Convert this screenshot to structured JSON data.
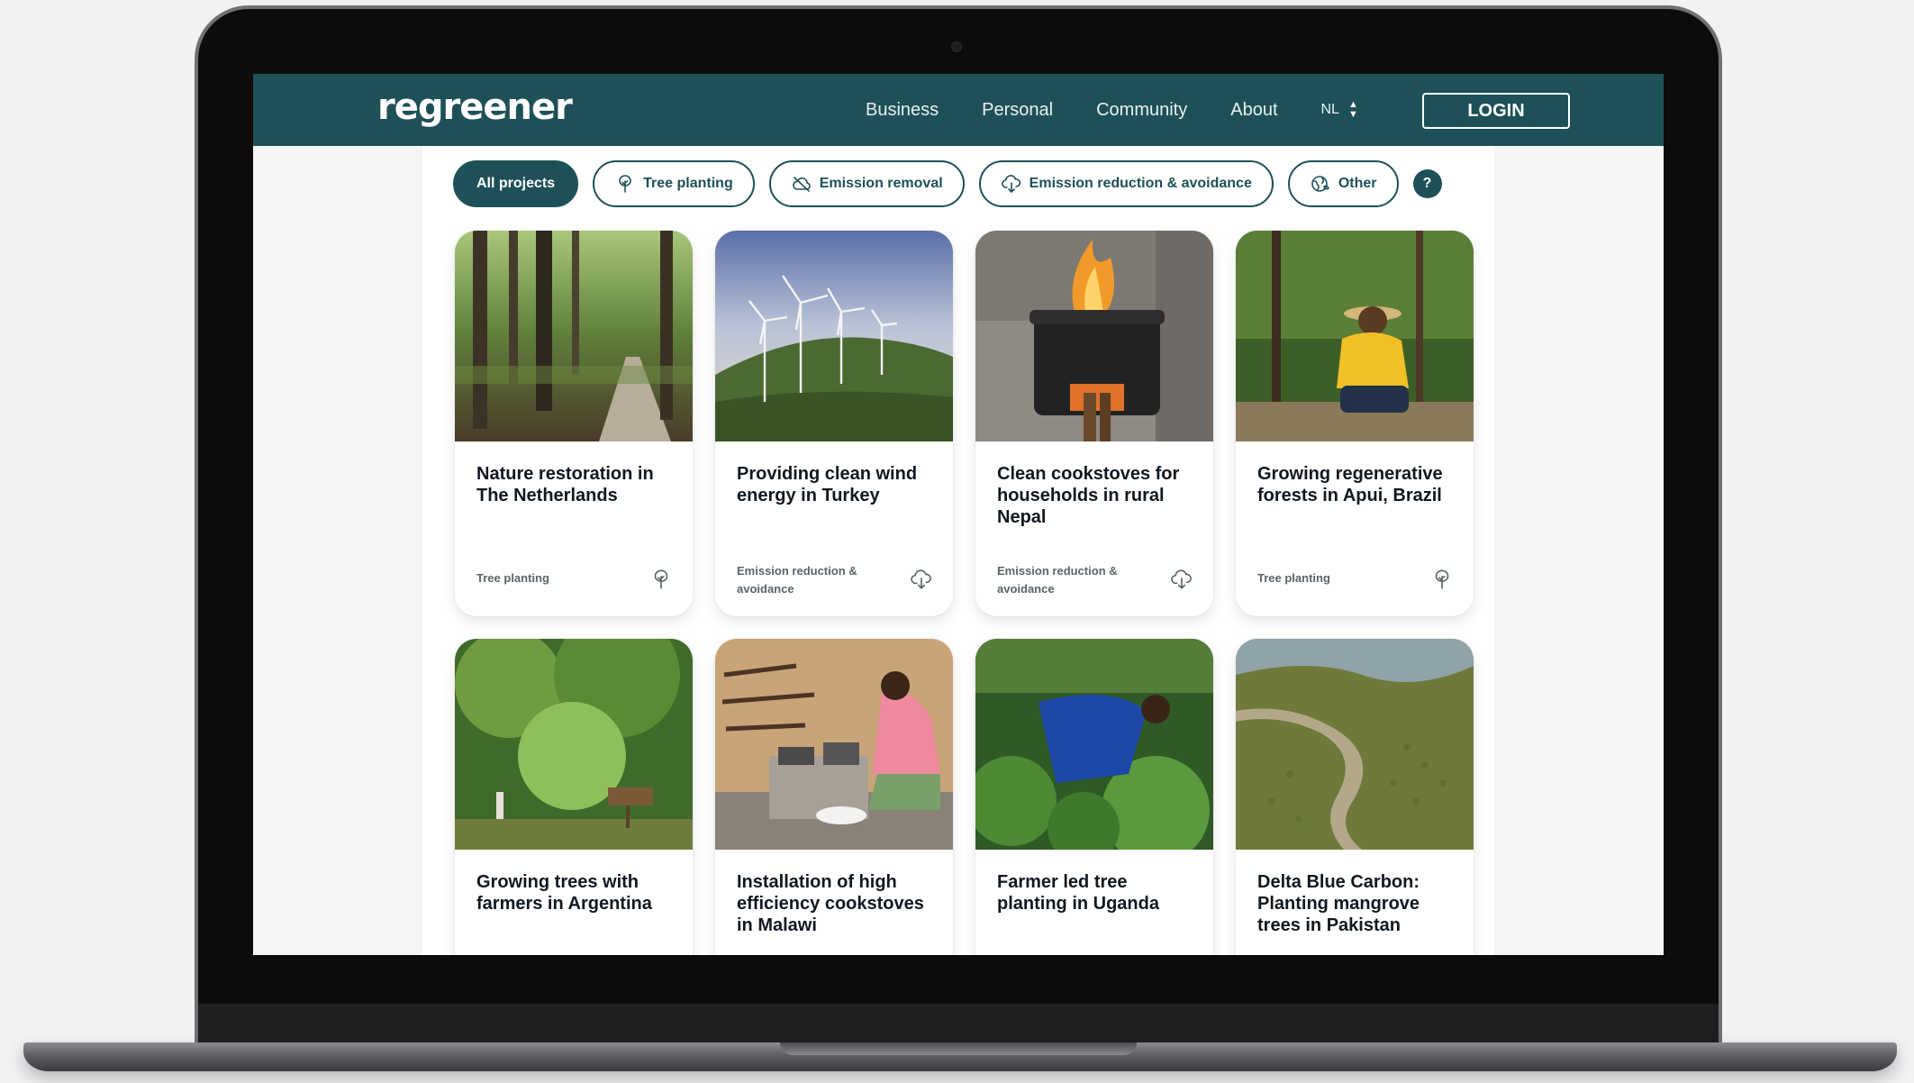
{
  "site": {
    "logo": "regreener",
    "nav": [
      "Business",
      "Personal",
      "Community",
      "About"
    ],
    "language": "NL",
    "login_label": "LOGIN"
  },
  "filters": {
    "chips": [
      {
        "label": "All projects",
        "icon": "",
        "active": true
      },
      {
        "label": "Tree planting",
        "icon": "tree-icon",
        "active": false
      },
      {
        "label": "Emission removal",
        "icon": "cloud-slash-icon",
        "active": false
      },
      {
        "label": "Emission reduction & avoidance",
        "icon": "cloud-download-icon",
        "active": false
      },
      {
        "label": "Other",
        "icon": "globe-leaf-icon",
        "active": false
      }
    ],
    "help_label": "?"
  },
  "projects": [
    {
      "title": "Nature restoration in The Netherlands",
      "category": "Tree planting",
      "icon": "tree-icon",
      "image": "forest-path"
    },
    {
      "title": "Providing clean wind energy in Turkey",
      "category": "Emission reduction & avoidance",
      "icon": "cloud-download-icon",
      "image": "wind-turbines"
    },
    {
      "title": "Clean cookstoves for households in rural Nepal",
      "category": "Emission reduction & avoidance",
      "icon": "cloud-download-icon",
      "image": "cookstove-fire"
    },
    {
      "title": "Growing regenerative forests in Apui, Brazil",
      "category": "Tree planting",
      "icon": "tree-icon",
      "image": "farmer-planting"
    },
    {
      "title": "Growing trees with farmers in Argentina",
      "category": "",
      "icon": "",
      "image": "jungle-trail"
    },
    {
      "title": "Installation of high efficiency cookstoves in Malawi",
      "category": "",
      "icon": "",
      "image": "cookstove-kitchen"
    },
    {
      "title": "Farmer led tree planting in Uganda",
      "category": "",
      "icon": "",
      "image": "farmer-field"
    },
    {
      "title": "Delta Blue Carbon: Planting mangrove trees in Pakistan",
      "category": "",
      "icon": "",
      "image": "mangrove-delta"
    }
  ],
  "colors": {
    "brand": "#1e5157",
    "text": "#101820",
    "muted": "#5b6468"
  }
}
